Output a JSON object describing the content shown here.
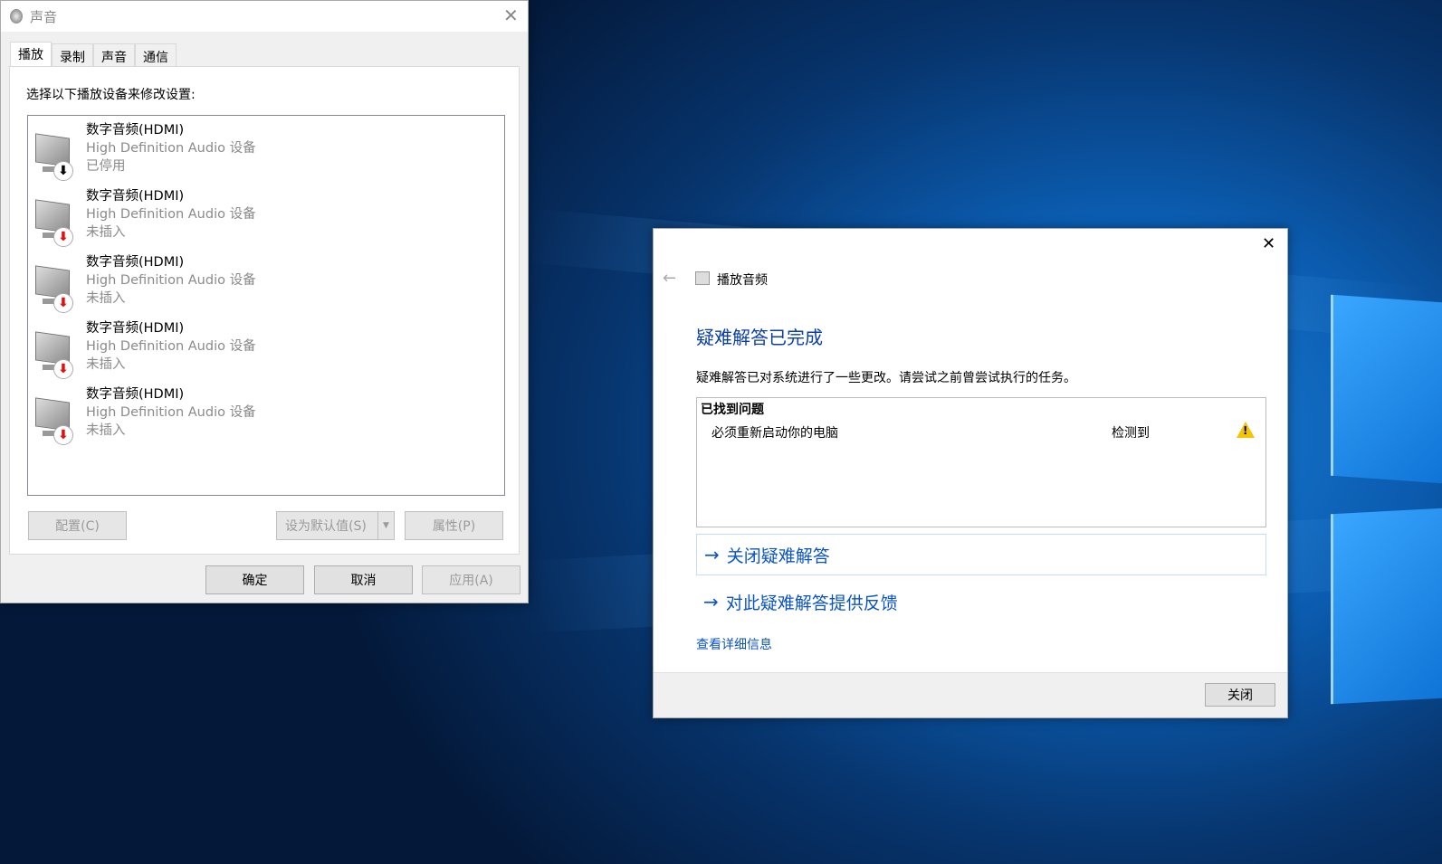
{
  "sound_dialog": {
    "title": "声音",
    "tabs": [
      "播放",
      "录制",
      "声音",
      "通信"
    ],
    "hint": "选择以下播放设备来修改设置:",
    "devices": [
      {
        "name": "数字音频(HDMI)",
        "driver": "High Definition Audio 设备",
        "status": "已停用",
        "badge": "disabled"
      },
      {
        "name": "数字音频(HDMI)",
        "driver": "High Definition Audio 设备",
        "status": "未插入",
        "badge": "unplugged"
      },
      {
        "name": "数字音频(HDMI)",
        "driver": "High Definition Audio 设备",
        "status": "未插入",
        "badge": "unplugged"
      },
      {
        "name": "数字音频(HDMI)",
        "driver": "High Definition Audio 设备",
        "status": "未插入",
        "badge": "unplugged"
      },
      {
        "name": "数字音频(HDMI)",
        "driver": "High Definition Audio 设备",
        "status": "未插入",
        "badge": "unplugged"
      }
    ],
    "configure": "配置(C)",
    "set_default": "设为默认值(S)",
    "properties": "属性(P)",
    "ok": "确定",
    "cancel": "取消",
    "apply": "应用(A)"
  },
  "troubleshooter": {
    "nav_title": "播放音频",
    "heading": "疑难解答已完成",
    "description": "疑难解答已对系统进行了一些更改。请尝试之前曾尝试执行的任务。",
    "problems_header": "已找到问题",
    "problems": [
      {
        "text": "必须重新启动你的电脑",
        "status": "检测到",
        "icon": "warning-icon"
      }
    ],
    "close_troubleshooter": "关闭疑难解答",
    "feedback": "对此疑难解答提供反馈",
    "details": "查看详细信息",
    "close_button": "关闭"
  },
  "colors": {
    "accent": "#0b54c5",
    "heading": "#0b3fa8",
    "warning": "#f5c400"
  }
}
